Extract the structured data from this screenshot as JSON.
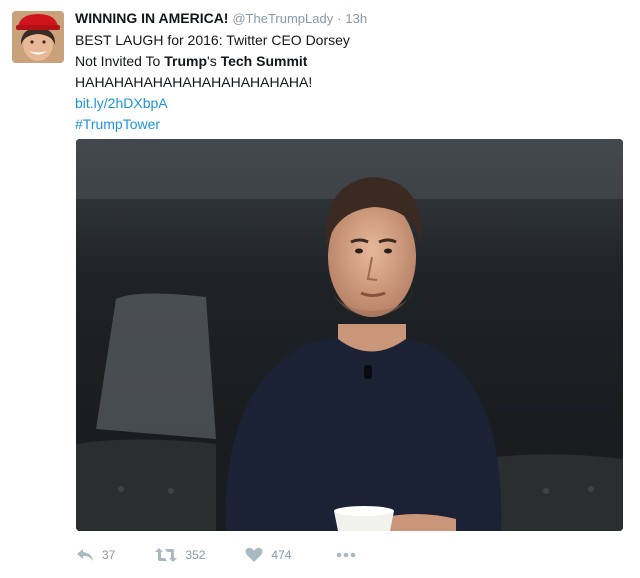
{
  "tweet": {
    "display_name": "WINNING IN AMERICA!",
    "handle": "@TheTrumpLady",
    "separator": "·",
    "time": "13h",
    "text": {
      "line1": "BEST LAUGH for 2016: Twitter CEO Dorsey",
      "line2_a": "Not Invited To ",
      "line2_b": "Trump",
      "line2_c": "'s ",
      "line2_d": "Tech Summit",
      "line3": "HAHAHAHAHAHAHAHAHAHAHAHA!",
      "link": "bit.ly/2hDXbpA",
      "hashtag": "#TrumpTower"
    },
    "stats": {
      "replies": "37",
      "retweets": "352",
      "likes": "474"
    }
  },
  "icons": {
    "reply": "reply-icon",
    "retweet": "retweet-icon",
    "like": "heart-icon",
    "more": "more-icon"
  },
  "colors": {
    "link": "#1b95e0",
    "muted": "#8899a6",
    "action_icon": "#aab8c2",
    "avatar_hat": "#d0141c"
  }
}
